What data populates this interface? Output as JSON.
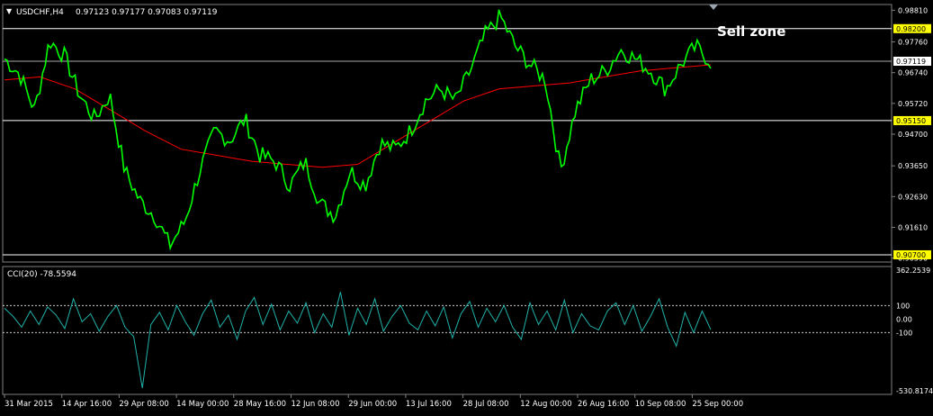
{
  "header": {
    "symbol": "USDCHF,H4",
    "ohlc": "0.97123 0.97177 0.97083 0.97119"
  },
  "annotation": "Sell zone",
  "indicator_label": "CCI(20) -78.5594",
  "colors": {
    "background": "#000000",
    "price": "#00ff00",
    "moving_average": "#ff0000",
    "cci": "#20b2aa",
    "level_lines": "#ffffff",
    "level_tag": "#ffff00",
    "grid": "#808080"
  },
  "chart_data": [
    {
      "type": "line",
      "title": "USDCHF,H4",
      "x": [
        "31 Mar 2015",
        "14 Apr 16:00",
        "29 Apr 08:00",
        "14 May 00:00",
        "28 May 16:00",
        "12 Jun 08:00",
        "29 Jun 00:00",
        "13 Jul 16:00",
        "28 Jul 08:00",
        "12 Aug 00:00",
        "26 Aug 16:00",
        "10 Sep 08:00",
        "25 Sep 00:00"
      ],
      "series": [
        {
          "values": [
            0.972,
            0.967,
            0.955,
            0.978,
            0.973,
            0.96,
            0.952,
            0.96,
            0.935,
            0.925,
            0.92,
            0.91,
            0.918,
            0.935,
            0.948,
            0.945,
            0.952,
            0.94,
            0.938,
            0.93,
            0.938,
            0.924,
            0.92,
            0.935,
            0.93,
            0.944,
            0.942,
            0.948,
            0.958,
            0.962,
            0.958,
            0.968,
            0.98,
            0.986,
            0.976,
            0.97,
            0.965,
            0.935,
            0.955,
            0.965,
            0.968,
            0.975,
            0.972,
            0.968,
            0.962,
            0.97,
            0.976,
            0.971
          ]
        },
        {
          "values": [
            0.965,
            0.966,
            0.962,
            0.955,
            0.948,
            0.942,
            0.94,
            0.938,
            0.937,
            0.936,
            0.937,
            0.944,
            0.951,
            0.958,
            0.962,
            0.963,
            0.964,
            0.966,
            0.968,
            0.969,
            0.97
          ]
        }
      ],
      "horizontal_levels": [
        0.982,
        0.9515,
        0.907
      ],
      "current_price": 0.97119,
      "y_ticks": [
        "0.98810",
        "0.97760",
        "0.96740",
        "0.95720",
        "0.94700",
        "0.93650",
        "0.92630",
        "0.91610",
        "0.90590"
      ],
      "level_tags": [
        "0.98200",
        "0.97119",
        "0.95150",
        "0.90700"
      ],
      "ylim": [
        0.9046,
        0.99
      ]
    },
    {
      "type": "line",
      "title": "CCI(20) -78.5594",
      "series": [
        {
          "values": [
            80,
            20,
            -60,
            60,
            -40,
            90,
            30,
            -70,
            150,
            -20,
            40,
            -90,
            20,
            100,
            -60,
            -130,
            -510,
            -40,
            50,
            -80,
            100,
            -20,
            -120,
            40,
            140,
            -60,
            30,
            -150,
            60,
            160,
            -40,
            110,
            -80,
            60,
            -30,
            120,
            -100,
            40,
            -60,
            200,
            -120,
            80,
            -40,
            150,
            -90,
            20,
            100,
            -30,
            -80,
            60,
            -50,
            90,
            -140,
            40,
            130,
            -60,
            80,
            -20,
            100,
            -60,
            -150,
            120,
            -40,
            60,
            -80,
            140,
            -100,
            40,
            -50,
            -80,
            60,
            120,
            -40,
            100,
            -90,
            20,
            150,
            -60,
            -200,
            50,
            -100,
            60,
            -78.5594
          ]
        }
      ],
      "y_ticks": [
        "362.2539",
        "100",
        "0.00",
        "-100",
        "-530.8174"
      ],
      "levels": [
        100,
        -100
      ],
      "ylim": [
        -530.8174,
        362.2539
      ]
    }
  ]
}
